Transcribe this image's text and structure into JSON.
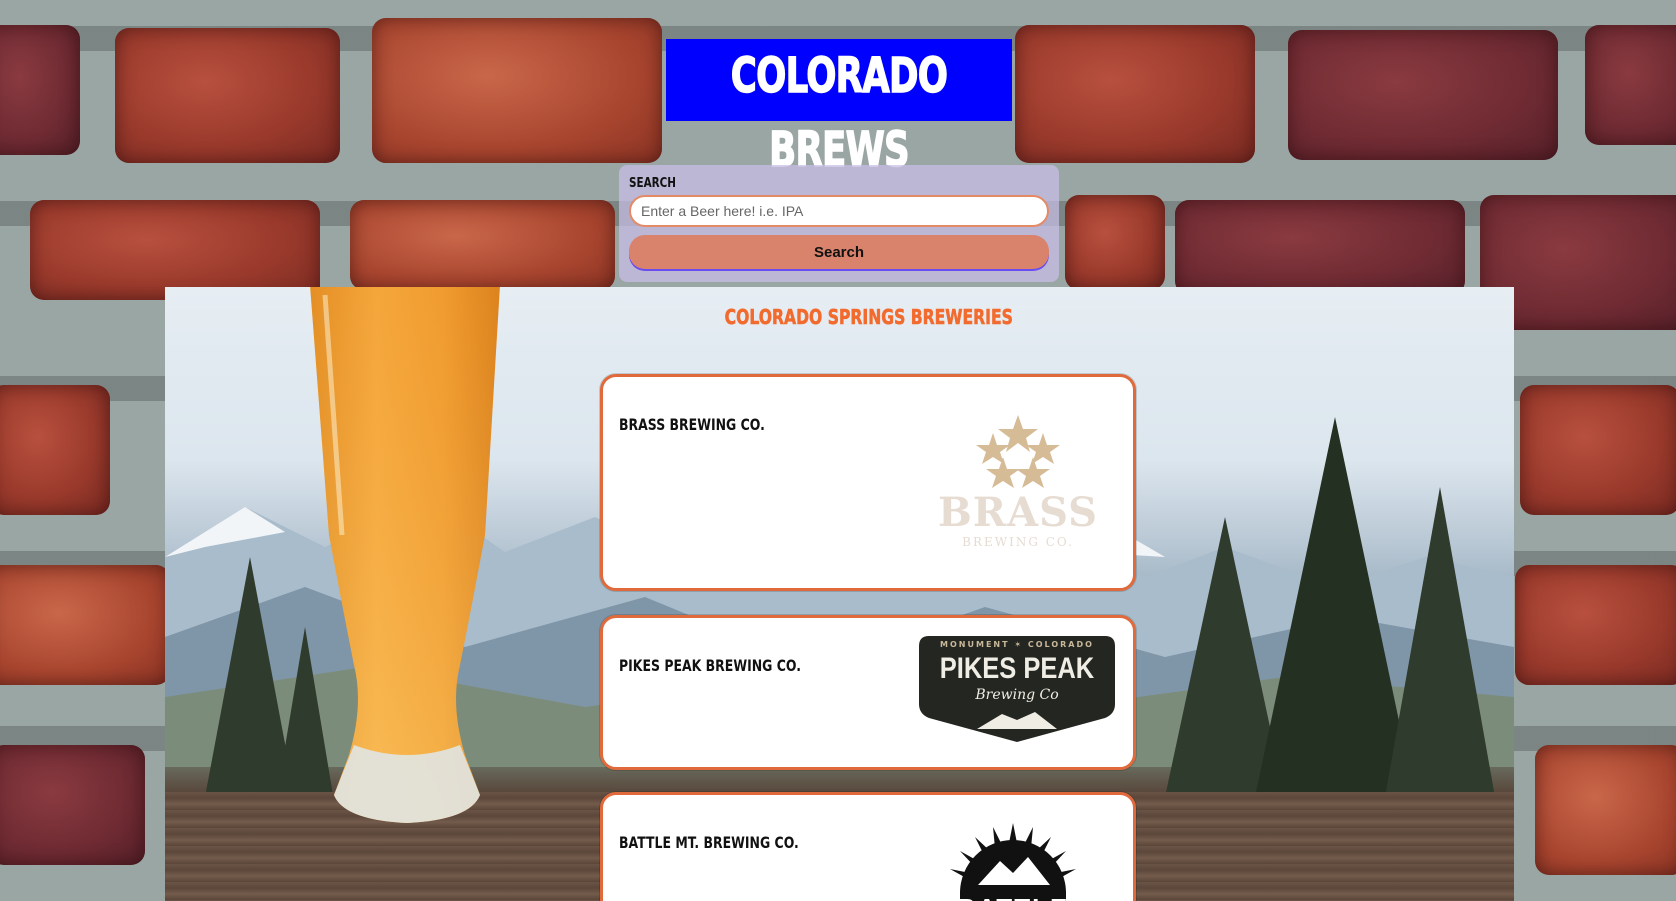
{
  "header": {
    "title": "COLORADO BREWS"
  },
  "search": {
    "label": "Search",
    "placeholder": "Enter a Beer here! i.e. IPA",
    "value": "",
    "button_label": "Search"
  },
  "main": {
    "heading": "Colorado Springs Breweries",
    "breweries": [
      {
        "name": "Brass Brewing Co.",
        "logo_text": "BRASS",
        "logo_subtext": "BREWING CO."
      },
      {
        "name": "Pikes Peak Brewing Co.",
        "logo_top": "MONUMENT ✶ COLORADO",
        "logo_text": "PIKES PEAK",
        "logo_subtext": "Brewing Co"
      },
      {
        "name": "Battle Mt. Brewing Co.",
        "logo_text": "BATTLE"
      }
    ]
  },
  "colors": {
    "title_bg": "#0000ff",
    "accent": "#e06a3c",
    "heading": "#f26b2e",
    "button": "#d9826c"
  }
}
